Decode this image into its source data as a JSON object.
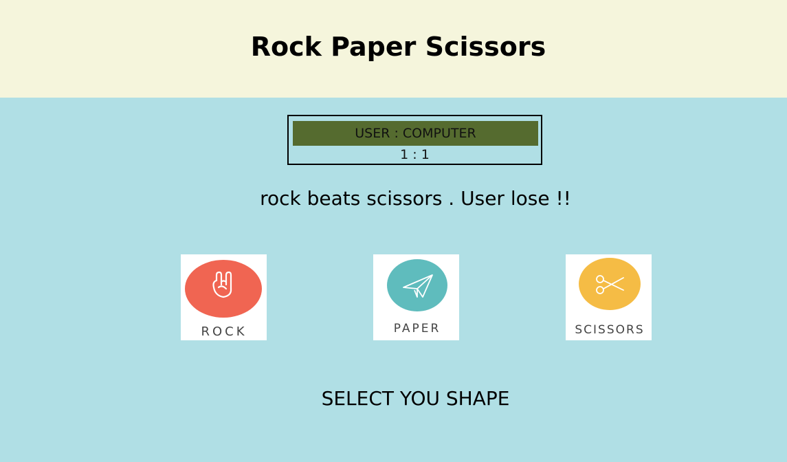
{
  "title": "Rock Paper Scissors",
  "scoreboard": {
    "label": "USER : COMPUTER",
    "score": "1 : 1"
  },
  "result_message": "rock beats scissors . User lose !!",
  "choices": [
    {
      "label": "ROCK",
      "color": "#f06552",
      "icon": "rock-hand-icon"
    },
    {
      "label": "PAPER",
      "color": "#5fbcbd",
      "icon": "paper-plane-icon"
    },
    {
      "label": "SCISSORS",
      "color": "#f5bc45",
      "icon": "scissors-icon"
    }
  ],
  "prompt": "SELECT YOU SHAPE",
  "colors": {
    "header_bg": "#f5f5dc",
    "page_bg": "#b0dfe5",
    "score_header_bg": "#556b2f"
  }
}
